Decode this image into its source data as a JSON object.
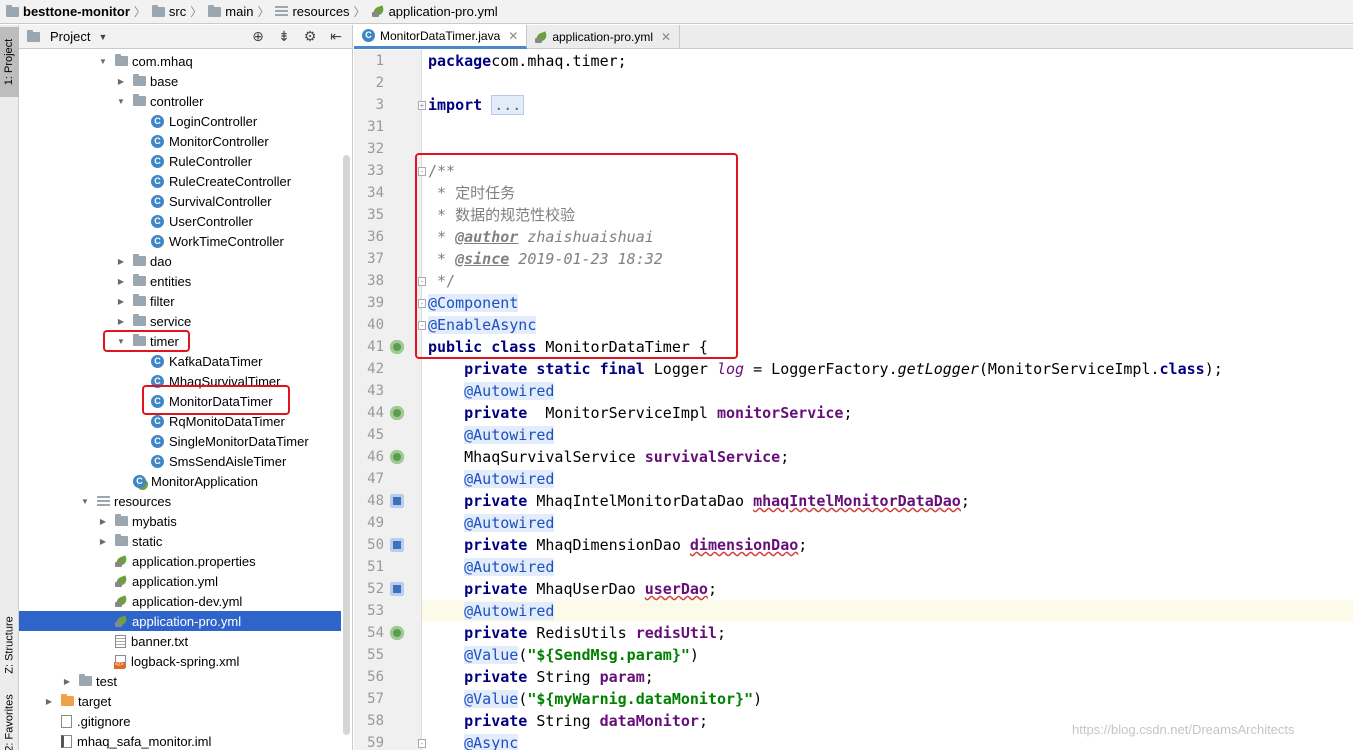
{
  "breadcrumb": [
    {
      "label": "besttone-monitor",
      "icon": "module-folder-icon"
    },
    {
      "label": "src",
      "icon": "folder-icon"
    },
    {
      "label": "main",
      "icon": "folder-icon"
    },
    {
      "label": "resources",
      "icon": "resources-folder-icon"
    },
    {
      "label": "application-pro.yml",
      "icon": "yml-file-icon"
    }
  ],
  "left_strip": {
    "project": "1: Project",
    "structure": "Z: Structure",
    "favorites": "2: Favorites"
  },
  "project_panel": {
    "title": "Project",
    "tree": [
      {
        "label": "com.mhaq",
        "icon": "package-icon",
        "arrow": "down"
      },
      {
        "label": "base",
        "icon": "package-icon",
        "arrow": "right"
      },
      {
        "label": "controller",
        "icon": "package-icon",
        "arrow": "down"
      },
      {
        "label": "LoginController",
        "icon": "class-icon",
        "arrow": ""
      },
      {
        "label": "MonitorController",
        "icon": "class-icon",
        "arrow": ""
      },
      {
        "label": "RuleController",
        "icon": "class-icon",
        "arrow": ""
      },
      {
        "label": "RuleCreateController",
        "icon": "class-icon",
        "arrow": ""
      },
      {
        "label": "SurvivalController",
        "icon": "class-icon",
        "arrow": ""
      },
      {
        "label": "UserController",
        "icon": "class-icon",
        "arrow": ""
      },
      {
        "label": "WorkTimeController",
        "icon": "class-icon",
        "arrow": ""
      },
      {
        "label": "dao",
        "icon": "package-icon",
        "arrow": "right"
      },
      {
        "label": "entities",
        "icon": "package-icon",
        "arrow": "right"
      },
      {
        "label": "filter",
        "icon": "package-icon",
        "arrow": "right"
      },
      {
        "label": "service",
        "icon": "package-icon",
        "arrow": "right"
      },
      {
        "label": "timer",
        "icon": "package-icon",
        "arrow": "down"
      },
      {
        "label": "KafkaDataTimer",
        "icon": "class-icon",
        "arrow": ""
      },
      {
        "label": "MhaqSurvivalTimer",
        "icon": "class-icon",
        "arrow": ""
      },
      {
        "label": "MonitorDataTimer",
        "icon": "class-icon",
        "arrow": ""
      },
      {
        "label": "RqMonitoDataTimer",
        "icon": "class-icon",
        "arrow": ""
      },
      {
        "label": "SingleMonitorDataTimer",
        "icon": "class-icon",
        "arrow": ""
      },
      {
        "label": "SmsSendAisleTimer",
        "icon": "class-icon",
        "arrow": ""
      },
      {
        "label": "MonitorApplication",
        "icon": "spring-app-icon",
        "arrow": ""
      },
      {
        "label": "resources",
        "icon": "resources-folder-icon",
        "arrow": "down"
      },
      {
        "label": "mybatis",
        "icon": "folder-icon",
        "arrow": "right"
      },
      {
        "label": "static",
        "icon": "folder-icon",
        "arrow": "right"
      },
      {
        "label": "application.properties",
        "icon": "spring-config-icon",
        "arrow": ""
      },
      {
        "label": "application.yml",
        "icon": "spring-config-icon",
        "arrow": ""
      },
      {
        "label": "application-dev.yml",
        "icon": "spring-config-icon",
        "arrow": ""
      },
      {
        "label": "application-pro.yml",
        "icon": "spring-config-icon",
        "arrow": "",
        "selected": true
      },
      {
        "label": "banner.txt",
        "icon": "text-file-icon",
        "arrow": ""
      },
      {
        "label": "logback-spring.xml",
        "icon": "xml-file-icon",
        "arrow": ""
      },
      {
        "label": "test",
        "icon": "folder-icon",
        "arrow": "right"
      },
      {
        "label": "target",
        "icon": "excluded-folder-icon",
        "arrow": "right"
      },
      {
        "label": ".gitignore",
        "icon": "gitignore-file-icon",
        "arrow": ""
      },
      {
        "label": "mhaq_safa_monitor.iml",
        "icon": "iml-file-icon",
        "arrow": ""
      }
    ]
  },
  "tabs": [
    {
      "label": "MonitorDataTimer.java",
      "icon": "class-icon",
      "active": true
    },
    {
      "label": "application-pro.yml",
      "icon": "yml-file-icon",
      "active": false
    }
  ],
  "editor": {
    "lines": [
      {
        "n": "1",
        "tokens": [
          [
            "kw",
            "package"
          ],
          [
            "",
            "com.mhaq.timer;"
          ]
        ]
      },
      {
        "n": "2",
        "tokens": []
      },
      {
        "n": "3",
        "tokens": [
          [
            "kw",
            "import"
          ],
          [
            "",
            " "
          ],
          [
            "dots",
            "..."
          ]
        ]
      },
      {
        "n": "31",
        "tokens": []
      },
      {
        "n": "32",
        "tokens": []
      },
      {
        "n": "33",
        "tokens": [
          [
            "cm",
            "/**"
          ]
        ]
      },
      {
        "n": "34",
        "tokens": [
          [
            "cm",
            " * 定时任务"
          ]
        ]
      },
      {
        "n": "35",
        "tokens": [
          [
            "cm",
            " * 数据的规范性校验"
          ]
        ]
      },
      {
        "n": "36",
        "tokens": [
          [
            "cm",
            " * "
          ],
          [
            "tag",
            "@author"
          ],
          [
            "it",
            " zhaishuaishuai"
          ]
        ]
      },
      {
        "n": "37",
        "tokens": [
          [
            "cm",
            " * "
          ],
          [
            "tag",
            "@since"
          ],
          [
            "it",
            " 2019-01-23 18:32"
          ]
        ]
      },
      {
        "n": "38",
        "tokens": [
          [
            "cm",
            " */"
          ]
        ]
      },
      {
        "n": "39",
        "tokens": [
          [
            "ann",
            "@Component"
          ]
        ]
      },
      {
        "n": "40",
        "tokens": [
          [
            "ann",
            "@EnableAsync"
          ]
        ]
      },
      {
        "n": "41",
        "tokens": [
          [
            "kw",
            "public class"
          ],
          [
            "",
            " MonitorDataTimer {"
          ]
        ]
      },
      {
        "n": "42",
        "tokens": [
          [
            "",
            "    "
          ],
          [
            "kw",
            "private static final"
          ],
          [
            "",
            " Logger "
          ],
          [
            "sf",
            "log"
          ],
          [
            "",
            " = LoggerFactory."
          ],
          [
            "it2",
            "getLogger"
          ],
          [
            "",
            "(MonitorServiceImpl."
          ],
          [
            "kw",
            "class"
          ],
          [
            "",
            ");"
          ]
        ]
      },
      {
        "n": "43",
        "tokens": [
          [
            "",
            "    "
          ],
          [
            "ann",
            "@Autowired"
          ]
        ]
      },
      {
        "n": "44",
        "tokens": [
          [
            "",
            "    "
          ],
          [
            "kw",
            "private"
          ],
          [
            "",
            "  MonitorServiceImpl "
          ],
          [
            "fld",
            "monitorService"
          ],
          [
            "",
            ";"
          ]
        ]
      },
      {
        "n": "45",
        "tokens": [
          [
            "",
            "    "
          ],
          [
            "ann",
            "@Autowired"
          ]
        ]
      },
      {
        "n": "46",
        "tokens": [
          [
            "",
            "    MhaqSurvivalService "
          ],
          [
            "fld",
            "survivalService"
          ],
          [
            "",
            ";"
          ]
        ]
      },
      {
        "n": "47",
        "tokens": [
          [
            "",
            "    "
          ],
          [
            "ann",
            "@Autowired"
          ]
        ]
      },
      {
        "n": "48",
        "tokens": [
          [
            "",
            "    "
          ],
          [
            "kw",
            "private"
          ],
          [
            "",
            " MhaqIntelMonitorDataDao "
          ],
          [
            "fldw",
            "mhaqIntelMonitorDataDao"
          ],
          [
            "",
            ";"
          ]
        ]
      },
      {
        "n": "49",
        "tokens": [
          [
            "",
            "    "
          ],
          [
            "ann",
            "@Autowired"
          ]
        ]
      },
      {
        "n": "50",
        "tokens": [
          [
            "",
            "    "
          ],
          [
            "kw",
            "private"
          ],
          [
            "",
            " MhaqDimensionDao "
          ],
          [
            "fldw",
            "dimensionDao"
          ],
          [
            "",
            ";"
          ]
        ]
      },
      {
        "n": "51",
        "tokens": [
          [
            "",
            "    "
          ],
          [
            "ann",
            "@Autowired"
          ]
        ]
      },
      {
        "n": "52",
        "tokens": [
          [
            "",
            "    "
          ],
          [
            "kw",
            "private"
          ],
          [
            "",
            " MhaqUserDao "
          ],
          [
            "fldw",
            "userDao"
          ],
          [
            "",
            ";"
          ]
        ]
      },
      {
        "n": "53",
        "tokens": [
          [
            "",
            "    "
          ],
          [
            "ann",
            "@Autowired"
          ]
        ]
      },
      {
        "n": "54",
        "tokens": [
          [
            "",
            "    "
          ],
          [
            "kw",
            "private"
          ],
          [
            "",
            " RedisUtils "
          ],
          [
            "fld",
            "redisUtil"
          ],
          [
            "",
            ";"
          ]
        ]
      },
      {
        "n": "55",
        "tokens": [
          [
            "",
            "    "
          ],
          [
            "ann",
            "@Value"
          ],
          [
            "",
            "("
          ],
          [
            "st",
            "\"${SendMsg.param}\""
          ],
          [
            "",
            ")"
          ]
        ]
      },
      {
        "n": "56",
        "tokens": [
          [
            "",
            "    "
          ],
          [
            "kw",
            "private"
          ],
          [
            "",
            " String "
          ],
          [
            "fld",
            "param"
          ],
          [
            "",
            ";"
          ]
        ]
      },
      {
        "n": "57",
        "tokens": [
          [
            "",
            "    "
          ],
          [
            "ann",
            "@Value"
          ],
          [
            "",
            "("
          ],
          [
            "st",
            "\"${myWarnig.dataMonitor}\""
          ],
          [
            "",
            ")"
          ]
        ]
      },
      {
        "n": "58",
        "tokens": [
          [
            "",
            "    "
          ],
          [
            "kw",
            "private"
          ],
          [
            "",
            " String "
          ],
          [
            "fld",
            "dataMonitor"
          ],
          [
            "",
            ";"
          ]
        ]
      },
      {
        "n": "59",
        "tokens": [
          [
            "",
            "    "
          ],
          [
            "ann",
            "@Async"
          ]
        ]
      }
    ],
    "gutter_icons": [
      {
        "line": "41",
        "icon": "spring-bean-icon"
      },
      {
        "line": "44",
        "icon": "spring-bean-icon"
      },
      {
        "line": "46",
        "icon": "spring-bean-icon"
      },
      {
        "line": "48",
        "icon": "mybatis-mapper-icon"
      },
      {
        "line": "50",
        "icon": "mybatis-mapper-icon"
      },
      {
        "line": "52",
        "icon": "mybatis-mapper-icon"
      },
      {
        "line": "54",
        "icon": "spring-bean-icon"
      }
    ]
  },
  "watermark": "https://blog.csdn.net/DreamsArchitects",
  "colors": {
    "selection": "#2f65ca",
    "highlight_box": "#e0141e",
    "keyword": "#000080",
    "annotation": "#1d50c2"
  }
}
